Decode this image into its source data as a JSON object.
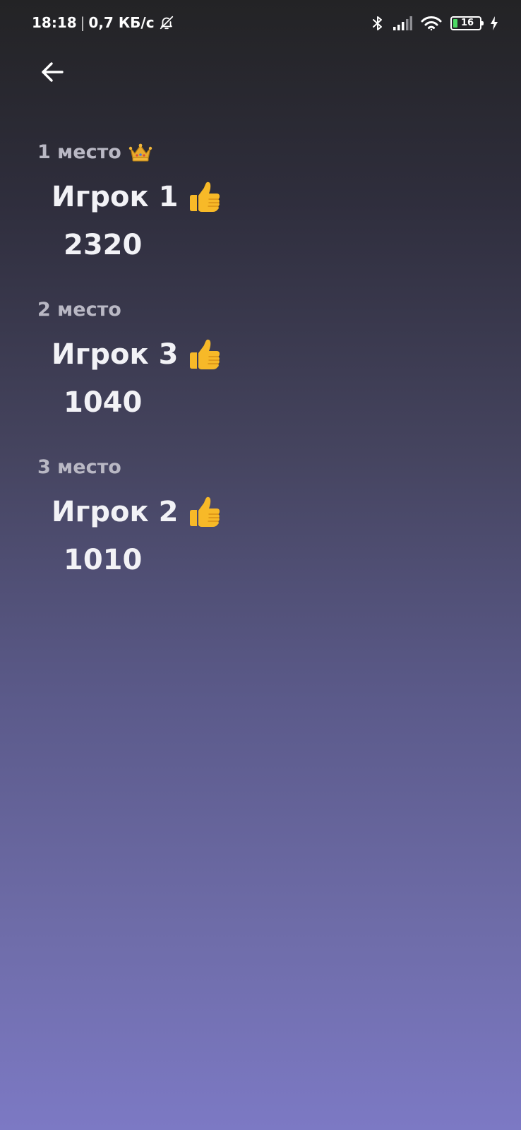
{
  "status_bar": {
    "time": "18:18",
    "separator": "|",
    "network_speed": "0,7 КБ/с",
    "battery_level": "16",
    "battery_color": "#4cd964",
    "icons": [
      "bell-off-icon",
      "bluetooth-icon",
      "signal-icon",
      "wifi-icon",
      "battery-icon",
      "charging-icon"
    ]
  },
  "header": {
    "back_icon": "arrow-left-icon"
  },
  "leaderboard": {
    "entries": [
      {
        "place": "1 место",
        "badge": "crown-icon",
        "name": "Игрок 1",
        "reaction": "thumbs-up-icon",
        "score": "2320"
      },
      {
        "place": "2 место",
        "badge": "",
        "name": "Игрок 3",
        "reaction": "thumbs-up-icon",
        "score": "1040"
      },
      {
        "place": "3 место",
        "badge": "",
        "name": "Игрок 2",
        "reaction": "thumbs-up-icon",
        "score": "1010"
      }
    ]
  },
  "colors": {
    "gradient_top": "#232325",
    "gradient_bottom": "#7c79c4",
    "place_text": "#b9b8c4",
    "emoji_yellow": "#f7b928",
    "crown_gold": "#e8a92c"
  }
}
